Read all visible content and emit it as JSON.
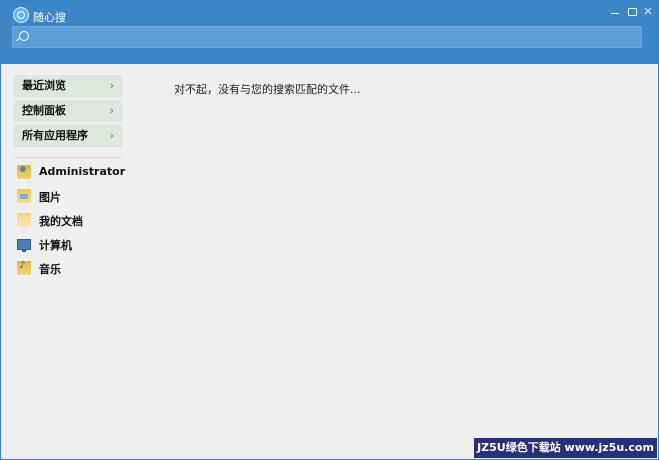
{
  "window": {
    "title": "随心搜",
    "minimize_icon": "minimize-icon",
    "maximize_icon": "maximize-icon",
    "close_label": "✕"
  },
  "search": {
    "placeholder": "",
    "value": "",
    "icon": "search-icon"
  },
  "sidebar": {
    "categories": [
      {
        "label": "最近浏览",
        "chevron": "›"
      },
      {
        "label": "控制面板",
        "chevron": "›"
      },
      {
        "label": "所有应用程序",
        "chevron": "›"
      }
    ],
    "folders": [
      {
        "label": "Administrator",
        "icon": "user-folder-icon"
      },
      {
        "label": "图片",
        "icon": "pictures-folder-icon"
      },
      {
        "label": "我的文档",
        "icon": "documents-folder-icon"
      },
      {
        "label": "计算机",
        "icon": "computer-icon"
      },
      {
        "label": "音乐",
        "icon": "music-folder-icon"
      }
    ]
  },
  "main": {
    "message": "对不起，没有与您的搜索匹配的文件..."
  },
  "watermark": {
    "text": "JZ5U绿色下载站 www.jz5u.com"
  }
}
